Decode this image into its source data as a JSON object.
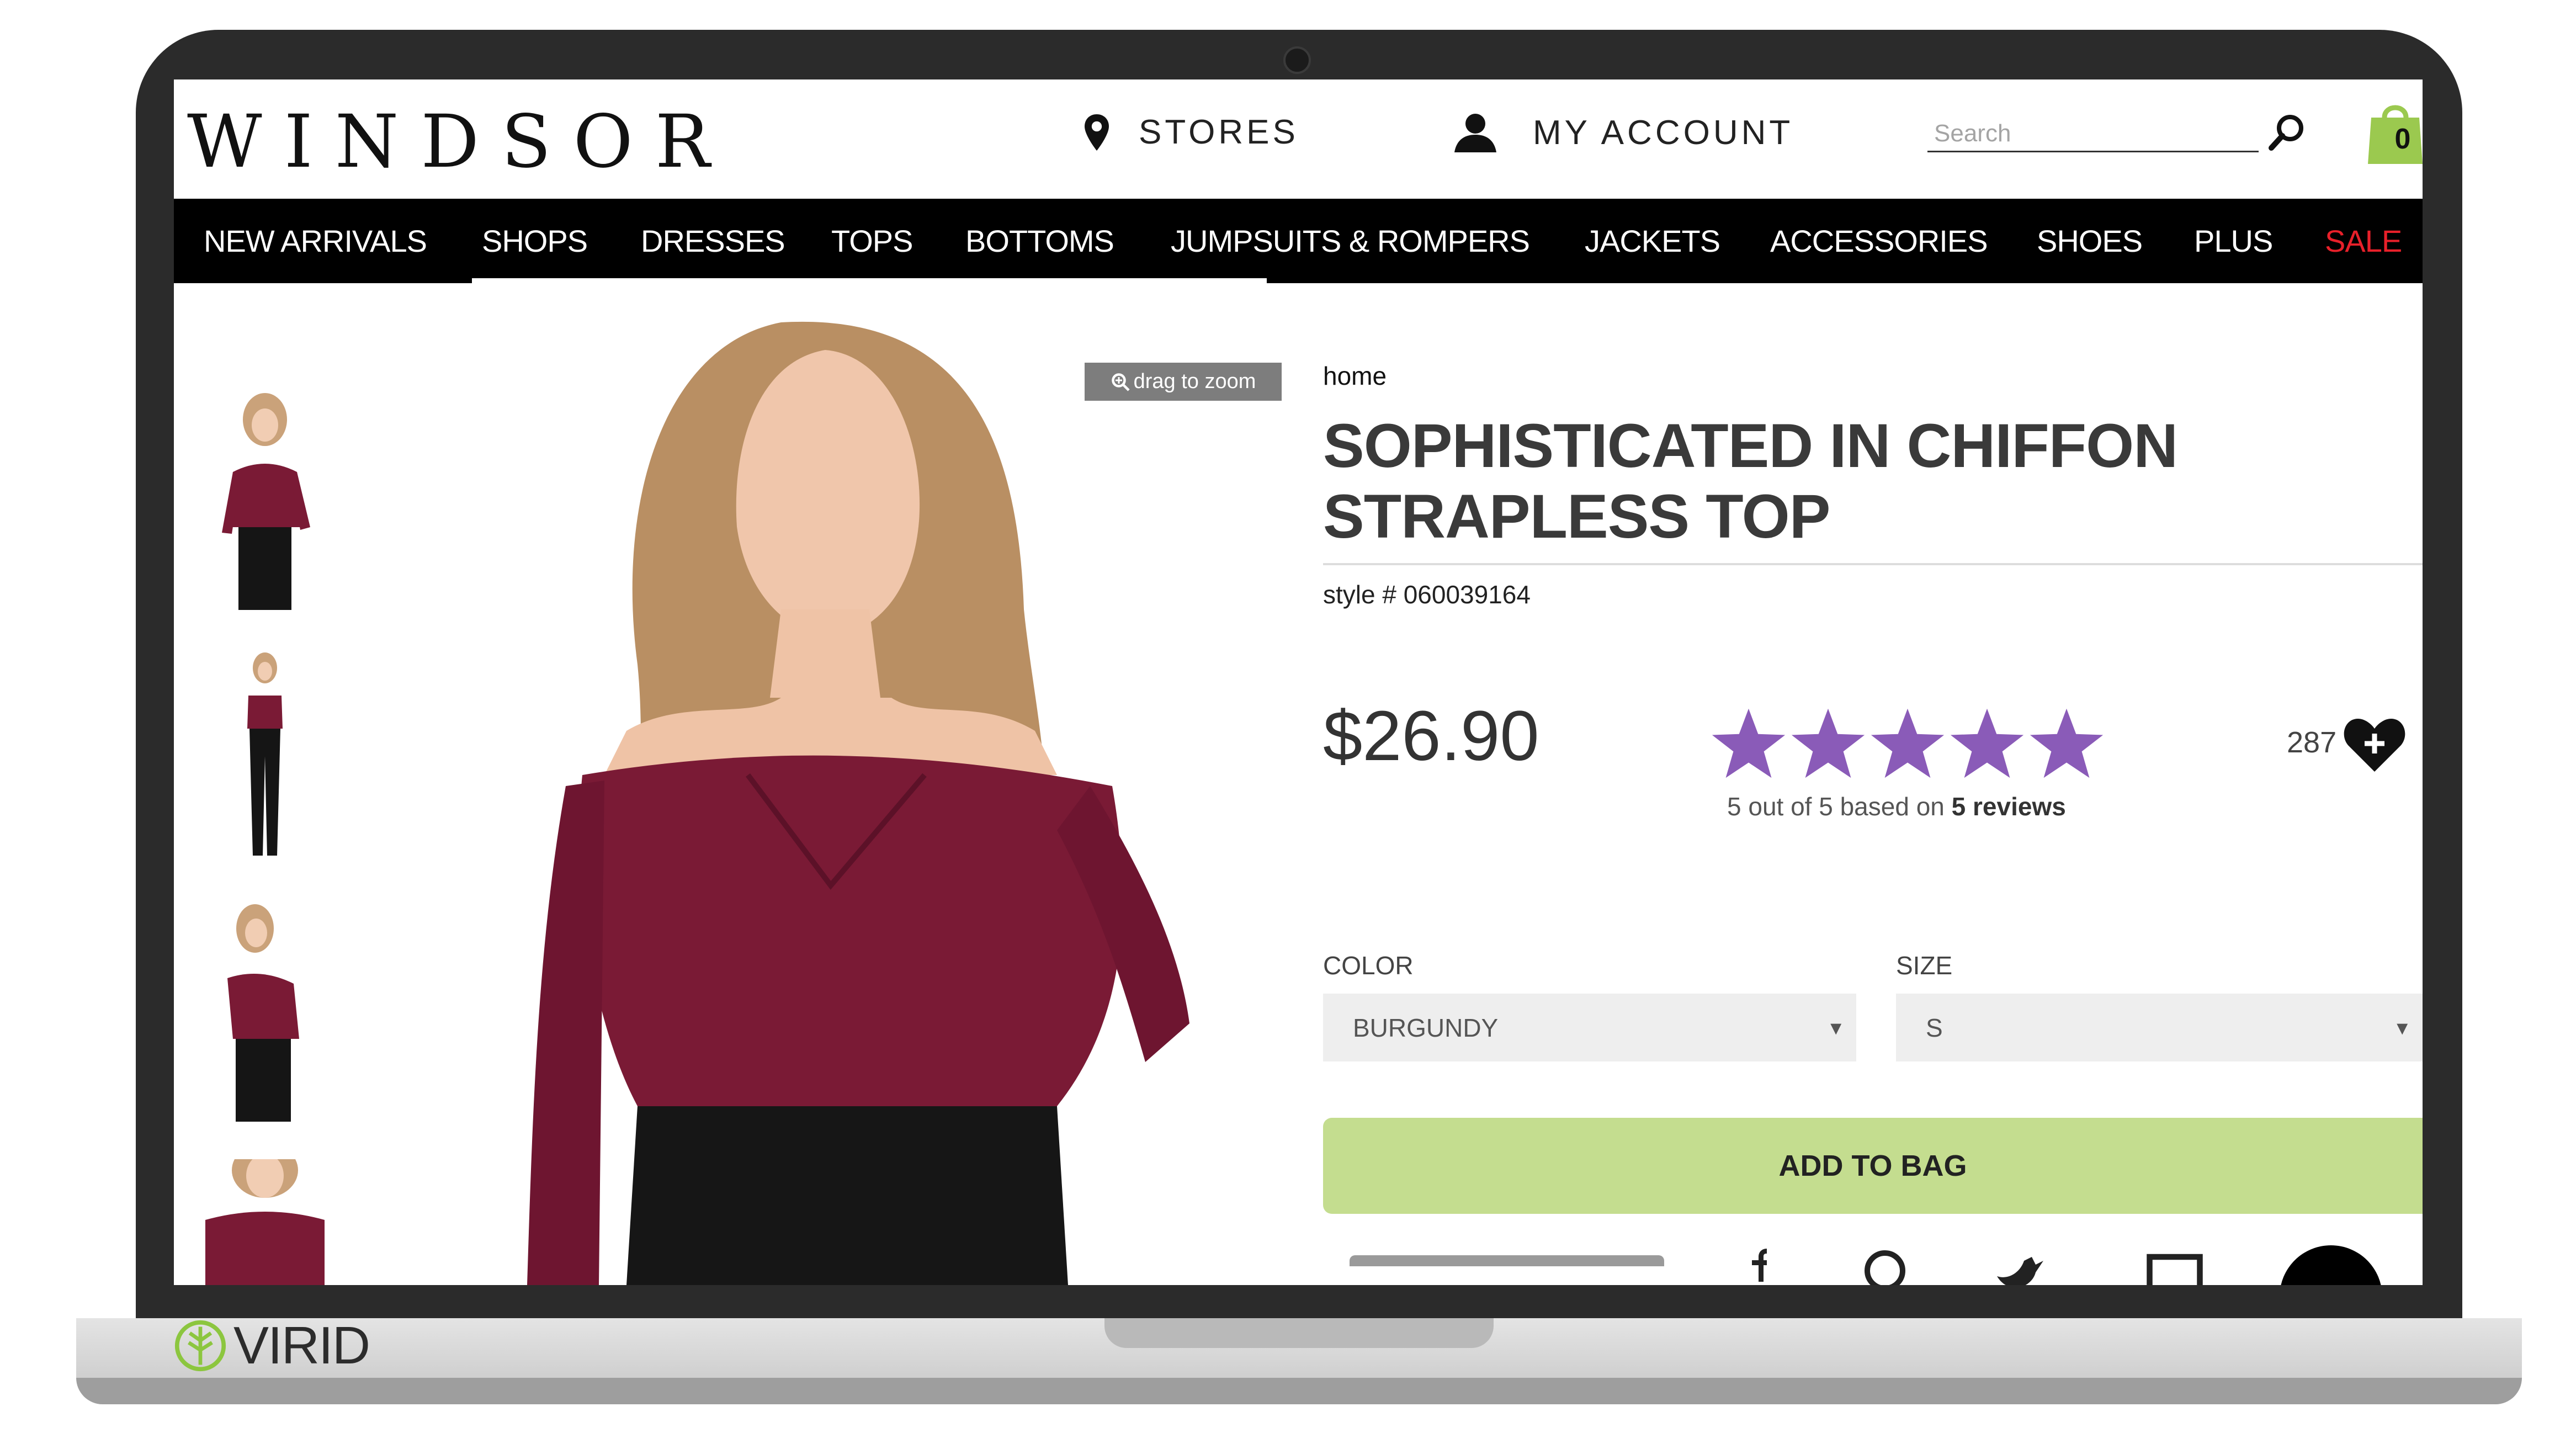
{
  "header": {
    "logo_text": "WINDSOR",
    "stores_label": "STORES",
    "account_label": "MY ACCOUNT",
    "search_placeholder": "Search",
    "bag_count": "0"
  },
  "nav": {
    "items": [
      "NEW ARRIVALS",
      "SHOPS",
      "DRESSES",
      "TOPS",
      "BOTTOMS",
      "JUMPSUITS & ROMPERS",
      "JACKETS",
      "ACCESSORIES",
      "SHOES",
      "PLUS",
      "SALE"
    ]
  },
  "gallery": {
    "zoom_label": "drag to zoom"
  },
  "product": {
    "breadcrumb": "home",
    "title_line1": "SOPHISTICATED IN CHIFFON",
    "title_line2": "STRAPLESS TOP",
    "style_number": "style # 060039164",
    "price": "$26.90",
    "rating_value": 5,
    "rating_max": 5,
    "rating_prefix": "5 out of 5 based on",
    "rating_reviews": "5 reviews",
    "wishlist_count": "287",
    "color_label": "COLOR",
    "color_value": "BURGUNDY",
    "size_label": "SIZE",
    "size_value": "S",
    "add_to_bag": "ADD TO BAG"
  },
  "laptop": {
    "brand": "VIRID"
  },
  "colors": {
    "nav_bg": "#000000",
    "sale": "#e8202a",
    "star": "#8a5bb8",
    "add_to_bag_bg": "#c4dd8f",
    "bag_green": "#9bc94f",
    "burgundy": "#7a1a35"
  }
}
